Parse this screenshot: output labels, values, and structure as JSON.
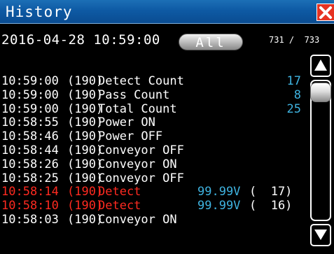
{
  "window": {
    "title": "History"
  },
  "header": {
    "datetime": "2016-04-28 10:59:00",
    "filter_label": "All",
    "counter_text": "731 /  733"
  },
  "colors": {
    "normal_text": "#ffffff",
    "alarm_text": "#ff2a20",
    "value_text": "#3fb3e0",
    "title_bar": "#0e5aa4",
    "close_button": "#e63323"
  },
  "icons": {
    "close": "close-x-icon",
    "scroll_up": "triangle-up-icon",
    "scroll_down": "triangle-down-icon"
  },
  "log": [
    {
      "time": "10:59:00",
      "code": "(190)",
      "event": "Detect Count",
      "value": "17",
      "volt": "",
      "extra": "",
      "alarm": false
    },
    {
      "time": "10:59:00",
      "code": "(190)",
      "event": "Pass Count",
      "value": "8",
      "volt": "",
      "extra": "",
      "alarm": false
    },
    {
      "time": "10:59:00",
      "code": "(190)",
      "event": "Total Count",
      "value": "25",
      "volt": "",
      "extra": "",
      "alarm": false
    },
    {
      "time": "10:58:55",
      "code": "(190)",
      "event": "Power ON",
      "value": "",
      "volt": "",
      "extra": "",
      "alarm": false
    },
    {
      "time": "10:58:46",
      "code": "(190)",
      "event": "Power OFF",
      "value": "",
      "volt": "",
      "extra": "",
      "alarm": false
    },
    {
      "time": "10:58:44",
      "code": "(190)",
      "event": "Conveyor OFF",
      "value": "",
      "volt": "",
      "extra": "",
      "alarm": false
    },
    {
      "time": "10:58:26",
      "code": "(190)",
      "event": "Conveyor ON",
      "value": "",
      "volt": "",
      "extra": "",
      "alarm": false
    },
    {
      "time": "10:58:25",
      "code": "(190)",
      "event": "Conveyor OFF",
      "value": "",
      "volt": "",
      "extra": "",
      "alarm": false
    },
    {
      "time": "10:58:14",
      "code": "(190)",
      "event": "Detect",
      "value": "",
      "volt": "99.99V",
      "extra": "(  17)",
      "alarm": true
    },
    {
      "time": "10:58:10",
      "code": "(190)",
      "event": "Detect",
      "value": "",
      "volt": "99.99V",
      "extra": "(  16)",
      "alarm": true
    },
    {
      "time": "10:58:03",
      "code": "(190)",
      "event": "Conveyor ON",
      "value": "",
      "volt": "",
      "extra": "",
      "alarm": false
    }
  ]
}
